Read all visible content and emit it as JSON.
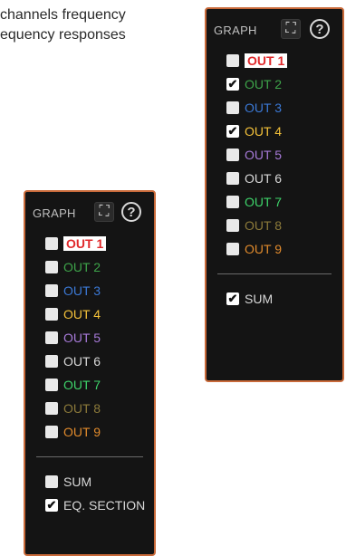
{
  "paragraph": {
    "line1": "channels frequency",
    "line2": "equency responses"
  },
  "panel_b": {
    "title": "GRAPH",
    "expand_icon": "expand-icon",
    "help_icon": "help-icon",
    "channels": [
      {
        "label": "OUT 1",
        "color": "#e0292b",
        "checked": false,
        "highlight": true
      },
      {
        "label": "OUT 2",
        "color": "#3ea44a",
        "checked": true,
        "highlight": false
      },
      {
        "label": "OUT 3",
        "color": "#3b79d6",
        "checked": false,
        "highlight": false
      },
      {
        "label": "OUT 4",
        "color": "#f5c23a",
        "checked": true,
        "highlight": false
      },
      {
        "label": "OUT 5",
        "color": "#a77ad9",
        "checked": false,
        "highlight": false
      },
      {
        "label": "OUT 6",
        "color": "#d8d8d8",
        "checked": false,
        "highlight": false
      },
      {
        "label": "OUT 7",
        "color": "#3ed46a",
        "checked": false,
        "highlight": false
      },
      {
        "label": "OUT 8",
        "color": "#8c7a3a",
        "checked": false,
        "highlight": false
      },
      {
        "label": "OUT 9",
        "color": "#e08a2c",
        "checked": false,
        "highlight": false
      }
    ],
    "extras": [
      {
        "label": "SUM",
        "color": "#d8d8d8",
        "checked": true
      }
    ]
  },
  "panel_a": {
    "title": "GRAPH",
    "expand_icon": "expand-icon",
    "help_icon": "help-icon",
    "channels": [
      {
        "label": "OUT 1",
        "color": "#e0292b",
        "checked": false,
        "highlight": true
      },
      {
        "label": "OUT 2",
        "color": "#3ea44a",
        "checked": false,
        "highlight": false
      },
      {
        "label": "OUT 3",
        "color": "#3b79d6",
        "checked": false,
        "highlight": false
      },
      {
        "label": "OUT 4",
        "color": "#f5c23a",
        "checked": false,
        "highlight": false
      },
      {
        "label": "OUT 5",
        "color": "#a77ad9",
        "checked": false,
        "highlight": false
      },
      {
        "label": "OUT 6",
        "color": "#d8d8d8",
        "checked": false,
        "highlight": false
      },
      {
        "label": "OUT 7",
        "color": "#3ed46a",
        "checked": false,
        "highlight": false
      },
      {
        "label": "OUT 8",
        "color": "#8c7a3a",
        "checked": false,
        "highlight": false
      },
      {
        "label": "OUT 9",
        "color": "#e08a2c",
        "checked": false,
        "highlight": false
      }
    ],
    "extras": [
      {
        "label": "SUM",
        "color": "#d8d8d8",
        "checked": false
      },
      {
        "label": "EQ. SECTION",
        "color": "#d8d8d8",
        "checked": true
      }
    ]
  }
}
